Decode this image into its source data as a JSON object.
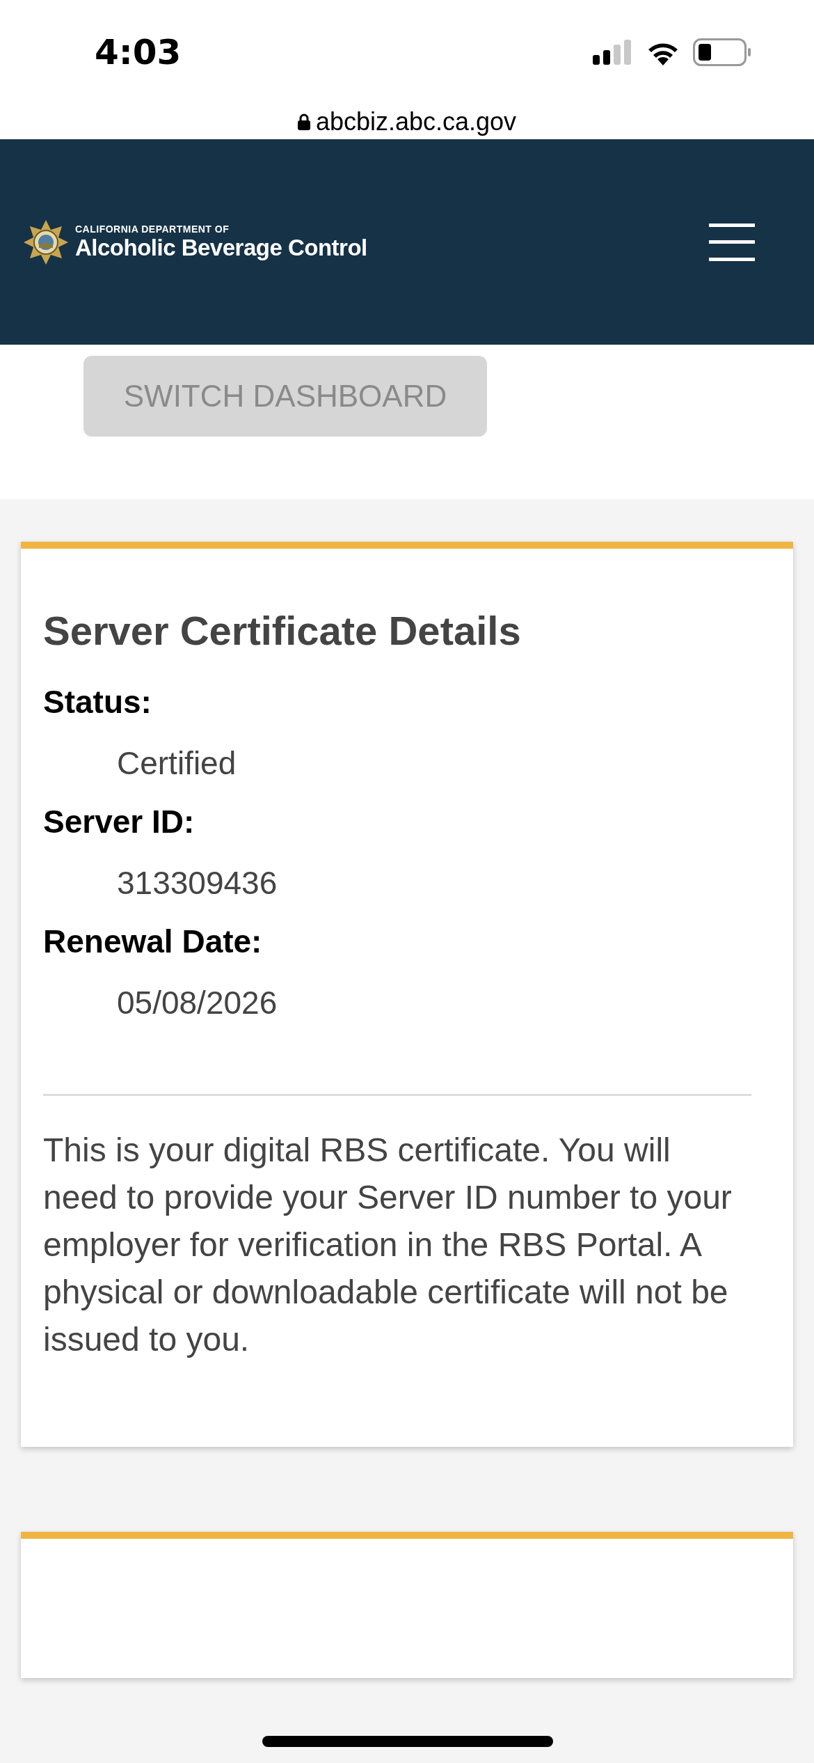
{
  "status_bar": {
    "time": "4:03"
  },
  "url_bar": {
    "url": "abcbiz.abc.ca.gov"
  },
  "header": {
    "eyebrow": "CALIFORNIA DEPARTMENT OF",
    "title": "Alcoholic Beverage Control"
  },
  "welcome": {
    "button": "SWITCH DASHBOARD",
    "button_disabled": true
  },
  "certificate_card": {
    "title": "Server Certificate Details",
    "fields": [
      {
        "label": "Status:",
        "value": "Certified"
      },
      {
        "label": "Server ID:",
        "value": "313309436"
      },
      {
        "label": "Renewal Date:",
        "value": "05/08/2026"
      }
    ],
    "note": "This is your digital RBS certificate. You will need to provide your Server ID number to your employer for verification in the RBS Portal. A physical or downloadable certificate will not be issued to you."
  }
}
